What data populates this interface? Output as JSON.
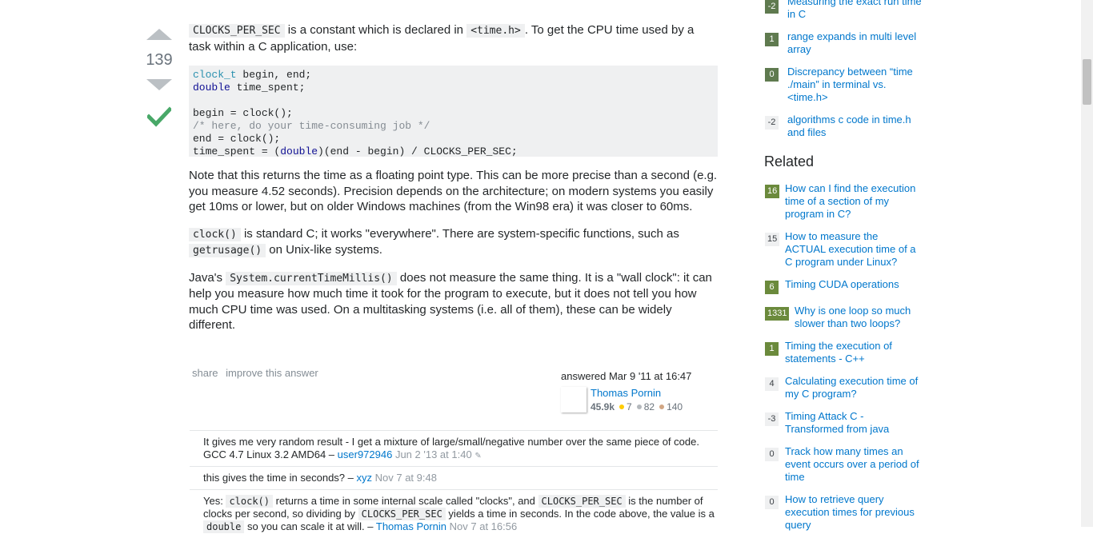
{
  "vote": {
    "count": "139"
  },
  "answer": {
    "p1": {
      "code1": "CLOCKS_PER_SEC",
      "text1": " is a constant which is declared in ",
      "code2": "<time.h>",
      "text2": ". To get the CPU time used by a task within a C application, use:"
    },
    "code_lines": [
      [
        "clock_t",
        " begin, end;"
      ],
      [
        "double",
        " time_spent;"
      ],
      [
        "",
        ""
      ],
      [
        "",
        "begin = clock();"
      ],
      [
        "/* here, do your time-consuming job */",
        ""
      ],
      [
        "",
        "end = clock();"
      ],
      [
        "time_spent = (",
        "double",
        ")(end - begin) / CLOCKS_PER_SEC;"
      ]
    ],
    "p2": "Note that this returns the time as a floating point type. This can be more precise than a second (e.g. you measure 4.52 seconds). Precision depends on the architecture; on modern systems you easily get 10ms or lower, but on older Windows machines (from the Win98 era) it was closer to 60ms.",
    "p3": {
      "code1": "clock()",
      "text1": " is standard C; it works \"everywhere\". There are system-specific functions, such as ",
      "code2": "getrusage()",
      "text2": " on Unix-like systems."
    },
    "p4": {
      "text1": "Java's ",
      "code1": "System.currentTimeMillis()",
      "text2": " does not measure the same thing. It is a \"wall clock\": it can help you measure how much time it took for the program to execute, but it does not tell you how much CPU time was used. On a multitasking systems (i.e. all of them), these can be widely different."
    },
    "menu": {
      "share": "share",
      "improve": "improve this answer"
    },
    "signature": {
      "action": "answered Mar 9 '11 at 16:47",
      "user": "Thomas Pornin",
      "rep": "45.9k",
      "gold": "7",
      "silver": "82",
      "bronze": "140"
    }
  },
  "comments": [
    {
      "text": "It gives me very random result - I get a mixture of large/small/negative number over the same piece of code. GCC 4.7 Linux 3.2 AMD64 – ",
      "user": "user972946",
      "date": "Jun 2 '13 at 1:40"
    },
    {
      "text": "this gives the time in seconds? – ",
      "user": "xyz",
      "date": "Nov 7 at 9:48"
    },
    {
      "t1": "Yes: ",
      "c1": "clock()",
      "t2": " returns a time in some internal scale called \"clocks\", and ",
      "c2": "CLOCKS_PER_SEC",
      "t3": " is the number of clocks per second, so dividing by ",
      "c3": "CLOCKS_PER_SEC",
      "t4": " yields a time in seconds. In the code above, the value is a ",
      "c4": "double",
      "t5": " so you can scale it at will. – ",
      "user": "Thomas Pornin",
      "date": "Nov 7 at 16:56"
    }
  ],
  "linked": [
    {
      "score": "-2",
      "title": "Measuring the exact run time in C",
      "style": "ans"
    },
    {
      "score": "1",
      "title": "range expands in multi level array",
      "style": "ans"
    },
    {
      "score": "0",
      "title": "Discrepancy between “time ./main” in terminal vs. <time.h>",
      "style": "ans"
    },
    {
      "score": "-2",
      "title": "algorithms c code in time.h and files",
      "style": "plain"
    }
  ],
  "related_heading": "Related",
  "related": [
    {
      "score": "16",
      "title": "How can I find the execution time of a section of my program in C?",
      "style": "ans"
    },
    {
      "score": "15",
      "title": "How to measure the ACTUAL execution time of a C program under Linux?",
      "style": "plain"
    },
    {
      "score": "6",
      "title": "Timing CUDA operations",
      "style": "ans"
    },
    {
      "score": "1331",
      "title": "Why is one loop so much slower than two loops?",
      "style": "ans"
    },
    {
      "score": "1",
      "title": "Timing the execution of statements - C++",
      "style": "ans"
    },
    {
      "score": "4",
      "title": "Calculating execution time of my C program?",
      "style": "plain"
    },
    {
      "score": "-3",
      "title": "Timing Attack C - Transformed from java",
      "style": "plain"
    },
    {
      "score": "0",
      "title": "Track how many times an event occurs over a period of time",
      "style": "plain"
    },
    {
      "score": "0",
      "title": "How to retrieve query execution times for previous query",
      "style": "plain"
    }
  ]
}
